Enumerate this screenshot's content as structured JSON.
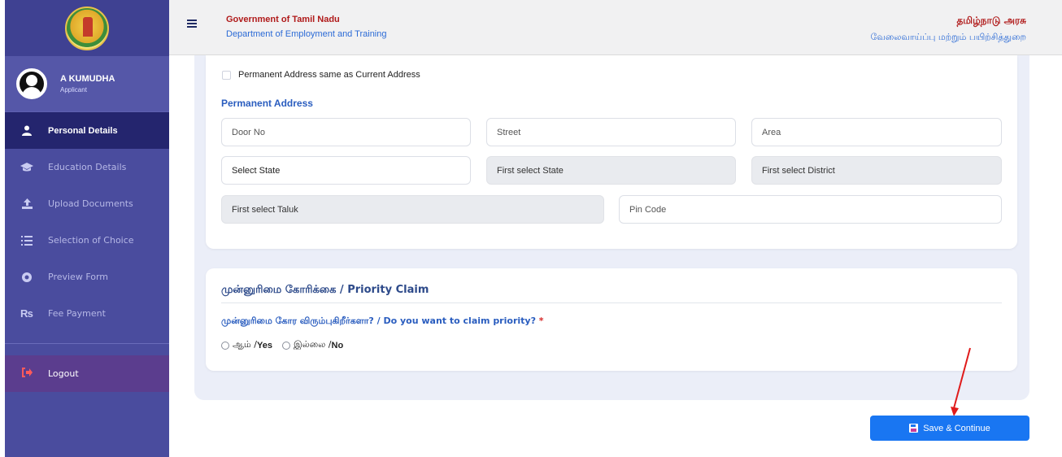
{
  "header": {
    "gov_en": "Government of Tamil Nadu",
    "dept_en": "Department of Employment and Training",
    "gov_ta": "தமிழ்நாடு அரசு",
    "dept_ta": "வேலைவாய்ப்பு மற்றும் பயிற்சித்துறை"
  },
  "user": {
    "name": "A KUMUDHA",
    "role": "Applicant"
  },
  "sidebar": {
    "items": [
      {
        "label": "Personal Details",
        "icon": "user-icon",
        "active": true
      },
      {
        "label": "Education Details",
        "icon": "graduation-cap-icon",
        "active": false
      },
      {
        "label": "Upload Documents",
        "icon": "upload-icon",
        "active": false
      },
      {
        "label": "Selection of Choice",
        "icon": "list-icon",
        "active": false
      },
      {
        "label": "Preview Form",
        "icon": "eye-icon",
        "active": false
      },
      {
        "label": "Fee Payment",
        "icon": "rupee-icon",
        "active": false
      }
    ],
    "logout": "Logout"
  },
  "address": {
    "same_label": "Permanent Address same as Current Address",
    "section_title": "Permanent Address",
    "fields": {
      "door_no": "Door No",
      "street": "Street",
      "area": "Area",
      "state": "Select State",
      "district": "First select State",
      "taluk": "First select District",
      "village": "First select Taluk",
      "pin": "Pin Code"
    }
  },
  "priority": {
    "title": "முன்னுரிமை கோரிக்கை / Priority Claim",
    "question": "முன்னுரிமை கோர விரும்புகிறீர்களா? / Do you want to claim priority?",
    "required": "*",
    "yes_ta": "ஆம் / ",
    "yes_en": "Yes",
    "no_ta": "இல்லை / ",
    "no_en": "No"
  },
  "actions": {
    "save_label": "Save & Continue"
  },
  "colors": {
    "sidebar": "#4a4c9e",
    "active_nav": "#24256e",
    "primary": "#1976f2",
    "gov_red": "#b01a1a",
    "link_blue": "#2c6bd6"
  }
}
